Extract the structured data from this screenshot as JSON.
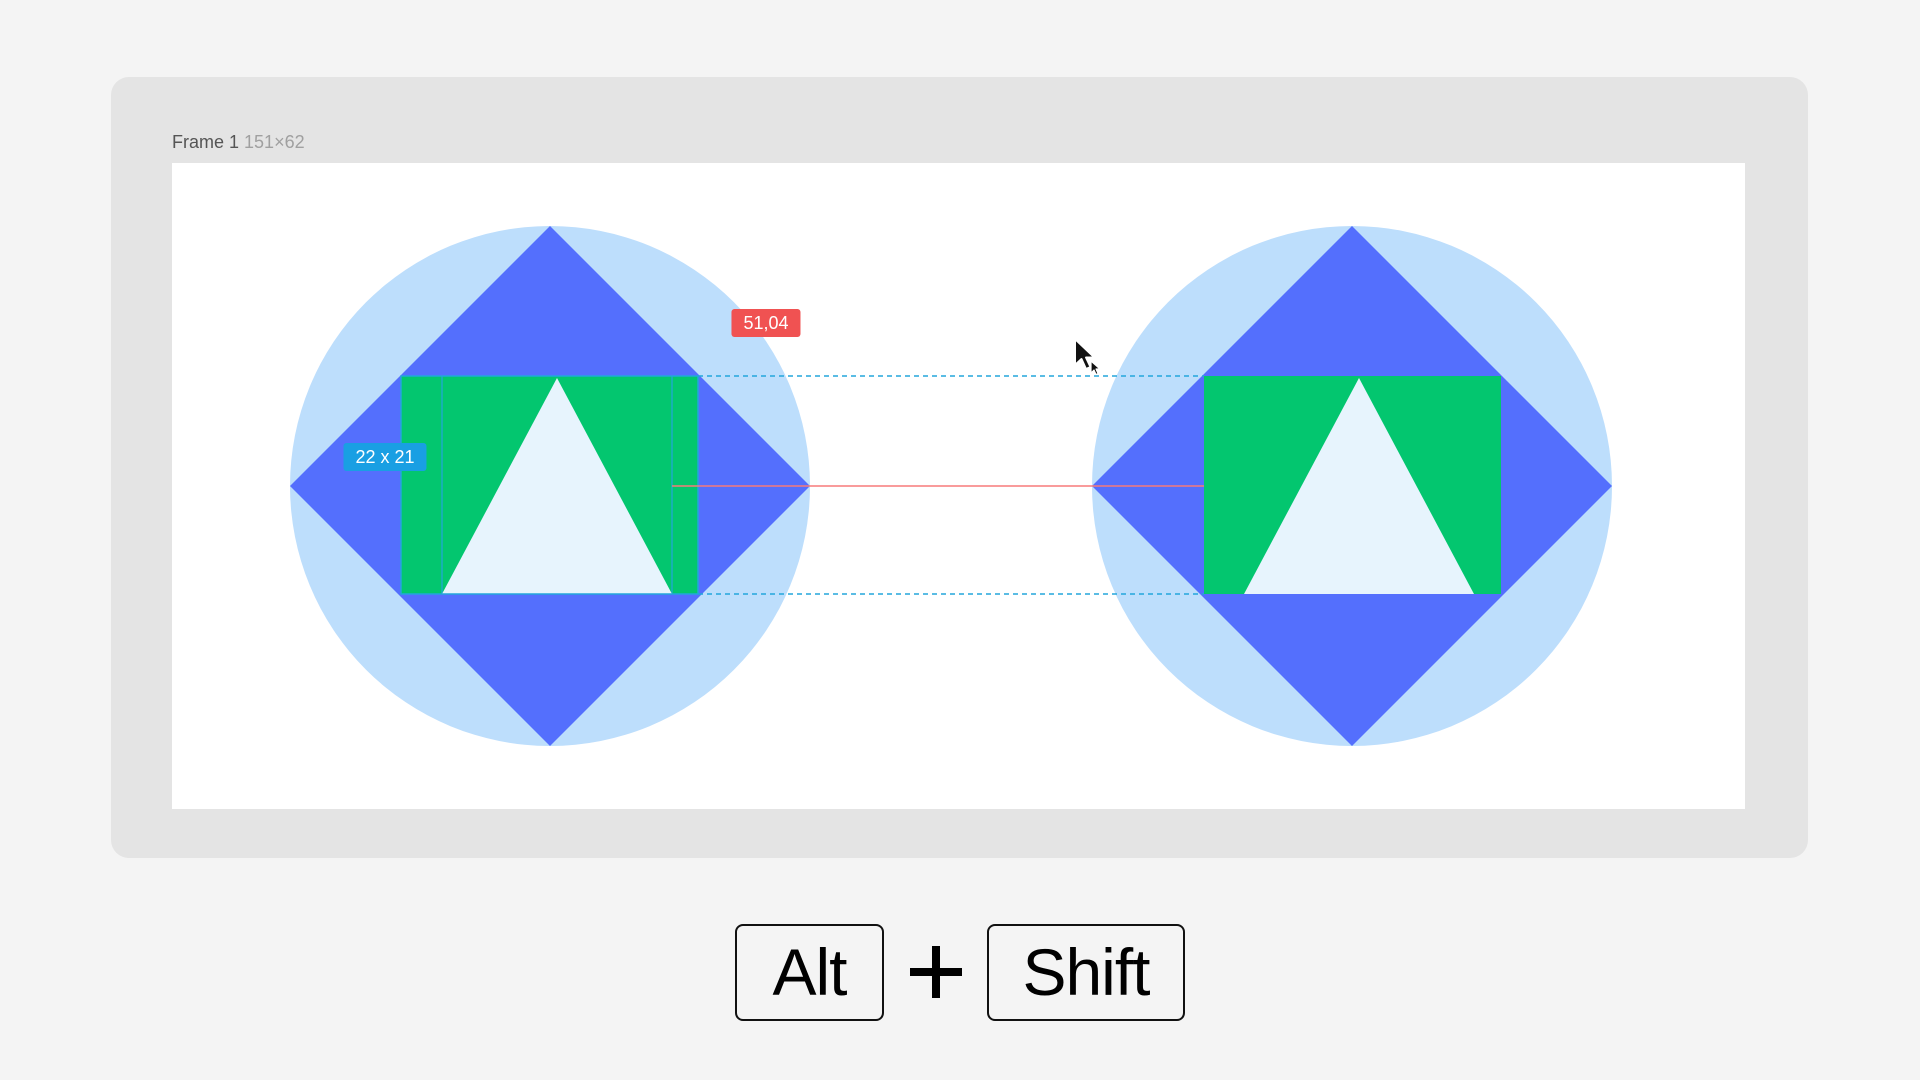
{
  "frame": {
    "name": "Frame 1",
    "dimensions": "151×62"
  },
  "measure": {
    "selection_size": "22 x 21",
    "distance": "51,04"
  },
  "shortcut": {
    "key1": "Alt",
    "key2": "Shift",
    "join_icon": "plus-icon"
  },
  "colors": {
    "background": "#f4f4f4",
    "canvas": "#e4e4e4",
    "frame_fill": "#ffffff",
    "circle": "#bddefc",
    "diamond": "#546ffd",
    "rect": "#03c66f",
    "triangle": "#e7f4fd",
    "selection_badge": "#199fe3",
    "guide": "#23a6dc",
    "distance_badge": "#f05252",
    "distance_line": "#f77a7a"
  },
  "cursor": {
    "icon": "pointer-arrow-icon"
  }
}
